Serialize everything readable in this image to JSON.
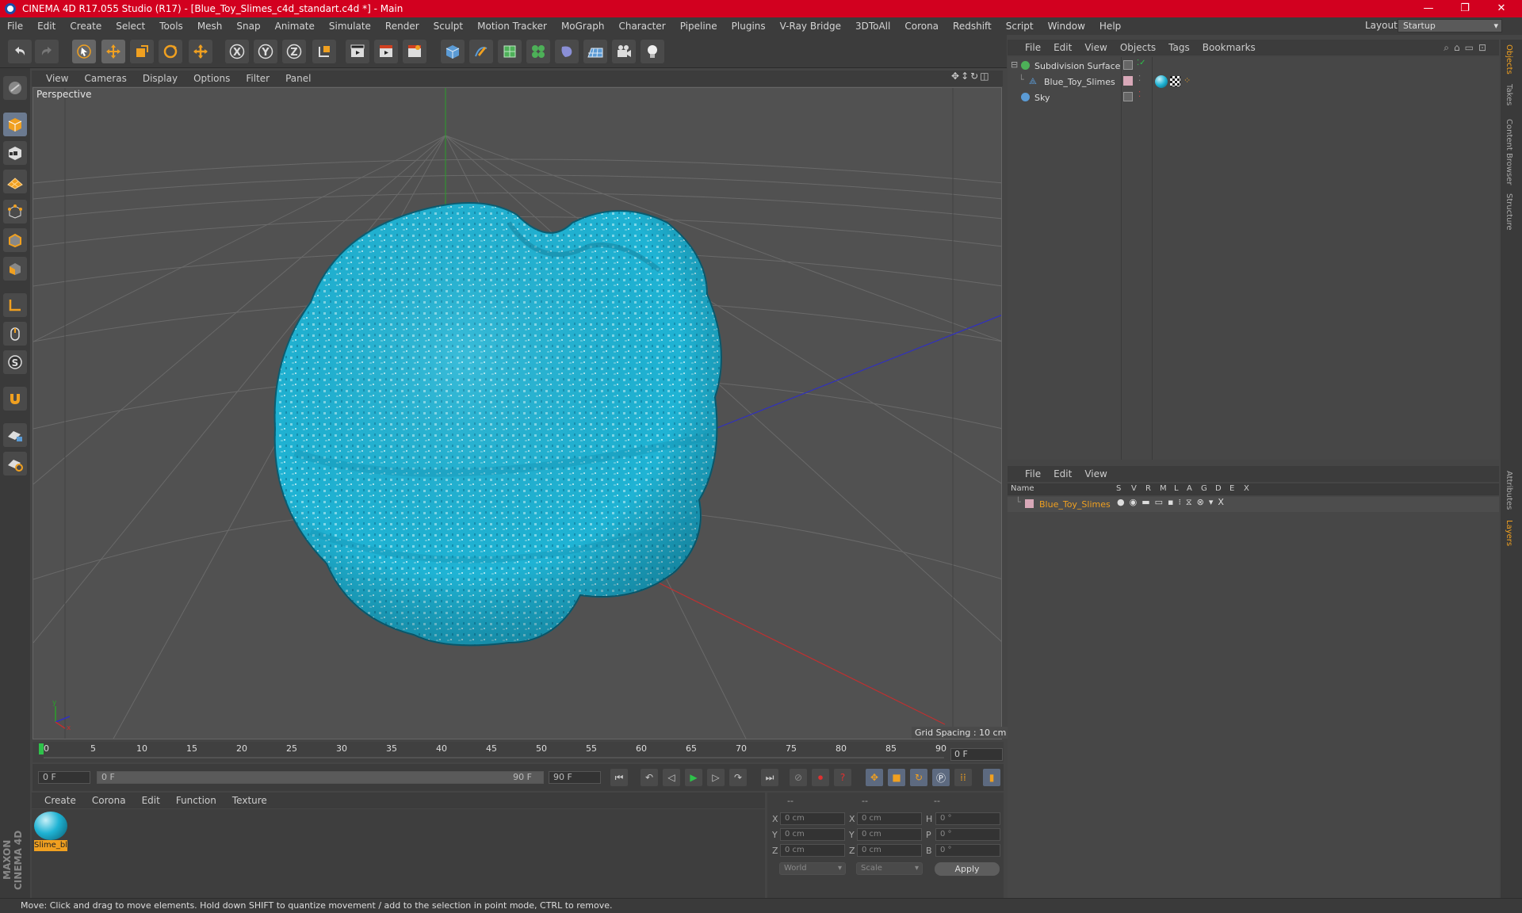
{
  "window": {
    "title": "CINEMA 4D R17.055 Studio (R17) - [Blue_Toy_Slimes_c4d_standart.c4d *] - Main"
  },
  "menubar": [
    "File",
    "Edit",
    "Create",
    "Select",
    "Tools",
    "Mesh",
    "Snap",
    "Animate",
    "Simulate",
    "Render",
    "Sculpt",
    "Motion Tracker",
    "MoGraph",
    "Character",
    "Pipeline",
    "Plugins",
    "V-Ray Bridge",
    "3DToAll",
    "Corona",
    "Redshift",
    "Script",
    "Window",
    "Help"
  ],
  "layout": {
    "label": "Layout:",
    "value": "Startup"
  },
  "toolbar": {
    "axis_x": "X",
    "axis_y": "Y",
    "axis_z": "Z"
  },
  "viewport": {
    "menu": [
      "View",
      "Cameras",
      "Display",
      "Options",
      "Filter",
      "Panel"
    ],
    "label": "Perspective",
    "grid_spacing": "Grid Spacing : 10 cm"
  },
  "timeline": {
    "ticks": [
      "0",
      "5",
      "10",
      "15",
      "20",
      "25",
      "30",
      "35",
      "40",
      "45",
      "50",
      "55",
      "60",
      "65",
      "70",
      "75",
      "80",
      "85",
      "90"
    ],
    "current_frame": "0 F",
    "start_field": "0 F",
    "range_start": "0 F",
    "range_end": "90 F",
    "end_field": "90 F"
  },
  "material_manager": {
    "menu": [
      "Create",
      "Corona",
      "Edit",
      "Function",
      "Texture"
    ],
    "materials": [
      {
        "name": "Slime_bl"
      }
    ]
  },
  "coordinates": {
    "headers": [
      "--",
      "--",
      "--"
    ],
    "rows": [
      {
        "a": "X",
        "av": "0 cm",
        "b": "X",
        "bv": "0 cm",
        "c": "H",
        "cv": "0 °"
      },
      {
        "a": "Y",
        "av": "0 cm",
        "b": "Y",
        "bv": "0 cm",
        "c": "P",
        "cv": "0 °"
      },
      {
        "a": "Z",
        "av": "0 cm",
        "b": "Z",
        "bv": "0 cm",
        "c": "B",
        "cv": "0 °"
      }
    ],
    "mode1": "World",
    "mode2": "Scale",
    "apply": "Apply"
  },
  "object_manager": {
    "menu": [
      "File",
      "Edit",
      "View",
      "Objects",
      "Tags",
      "Bookmarks"
    ],
    "objects": [
      {
        "name": "Subdivision Surface"
      },
      {
        "name": "Blue_Toy_Slimes"
      },
      {
        "name": "Sky"
      }
    ]
  },
  "layer_manager": {
    "menu": [
      "File",
      "Edit",
      "View"
    ],
    "columns": [
      "Name",
      "S",
      "V",
      "R",
      "M",
      "L",
      "A",
      "G",
      "D",
      "E",
      "X"
    ],
    "layers": [
      {
        "name": "Blue_Toy_Slimes"
      }
    ]
  },
  "right_tabs": [
    "Objects",
    "Takes",
    "Content Browser",
    "Structure",
    "Attributes",
    "Layers"
  ],
  "status": "Move: Click and drag to move elements. Hold down SHIFT to quantize movement / add to the selection in point mode, CTRL to remove.",
  "colors": {
    "title_bar": "#d2001f",
    "accent": "#f0a020",
    "slime": "#1fb3d4"
  }
}
